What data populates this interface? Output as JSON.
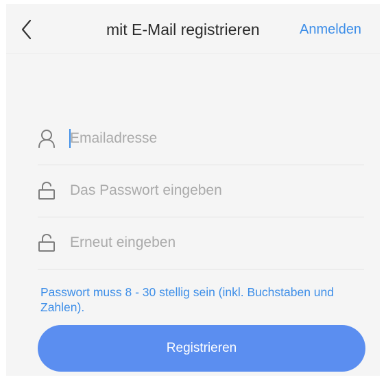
{
  "header": {
    "title": "mit E-Mail registrieren",
    "login_link": "Anmelden"
  },
  "form": {
    "email": {
      "value": "",
      "placeholder": "Emailadresse",
      "icon": "user-icon"
    },
    "password": {
      "value": "",
      "placeholder": "Das Passwort eingeben",
      "icon": "lock-icon"
    },
    "password_confirm": {
      "value": "",
      "placeholder": "Erneut eingeben",
      "icon": "lock-icon"
    },
    "hint": "Passwort muss 8 - 30 stellig sein (inkl. Buchstaben und Zahlen).",
    "submit_label": "Registrieren"
  },
  "colors": {
    "accent": "#3d8ee8",
    "button": "#5b8ef0",
    "background": "#f5f5f5"
  }
}
